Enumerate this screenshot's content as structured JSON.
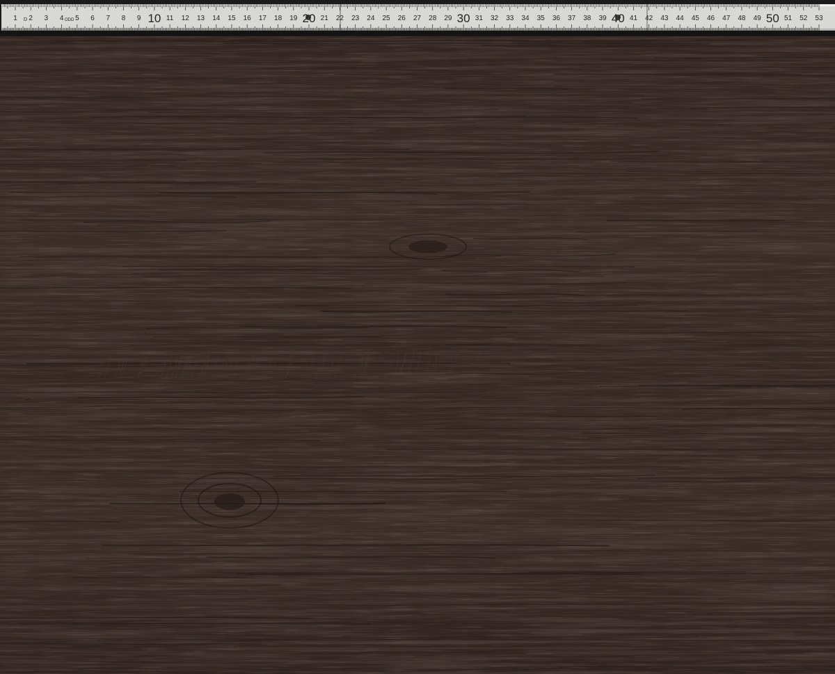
{
  "scene": {
    "subject": "wood-veneer-sample",
    "wood_color": "#3a2c27",
    "wood_dark": "#241a17",
    "wood_light": "#4b3a33",
    "ruler_color": "#d6d6d2",
    "ruler_ink": "#222222"
  },
  "ruler": {
    "unit": "cm",
    "first_number": 1,
    "last_number": 53,
    "large_numbers": [
      10,
      20,
      30,
      40,
      50
    ],
    "brand_marks": [
      "D",
      "ODD"
    ]
  }
}
